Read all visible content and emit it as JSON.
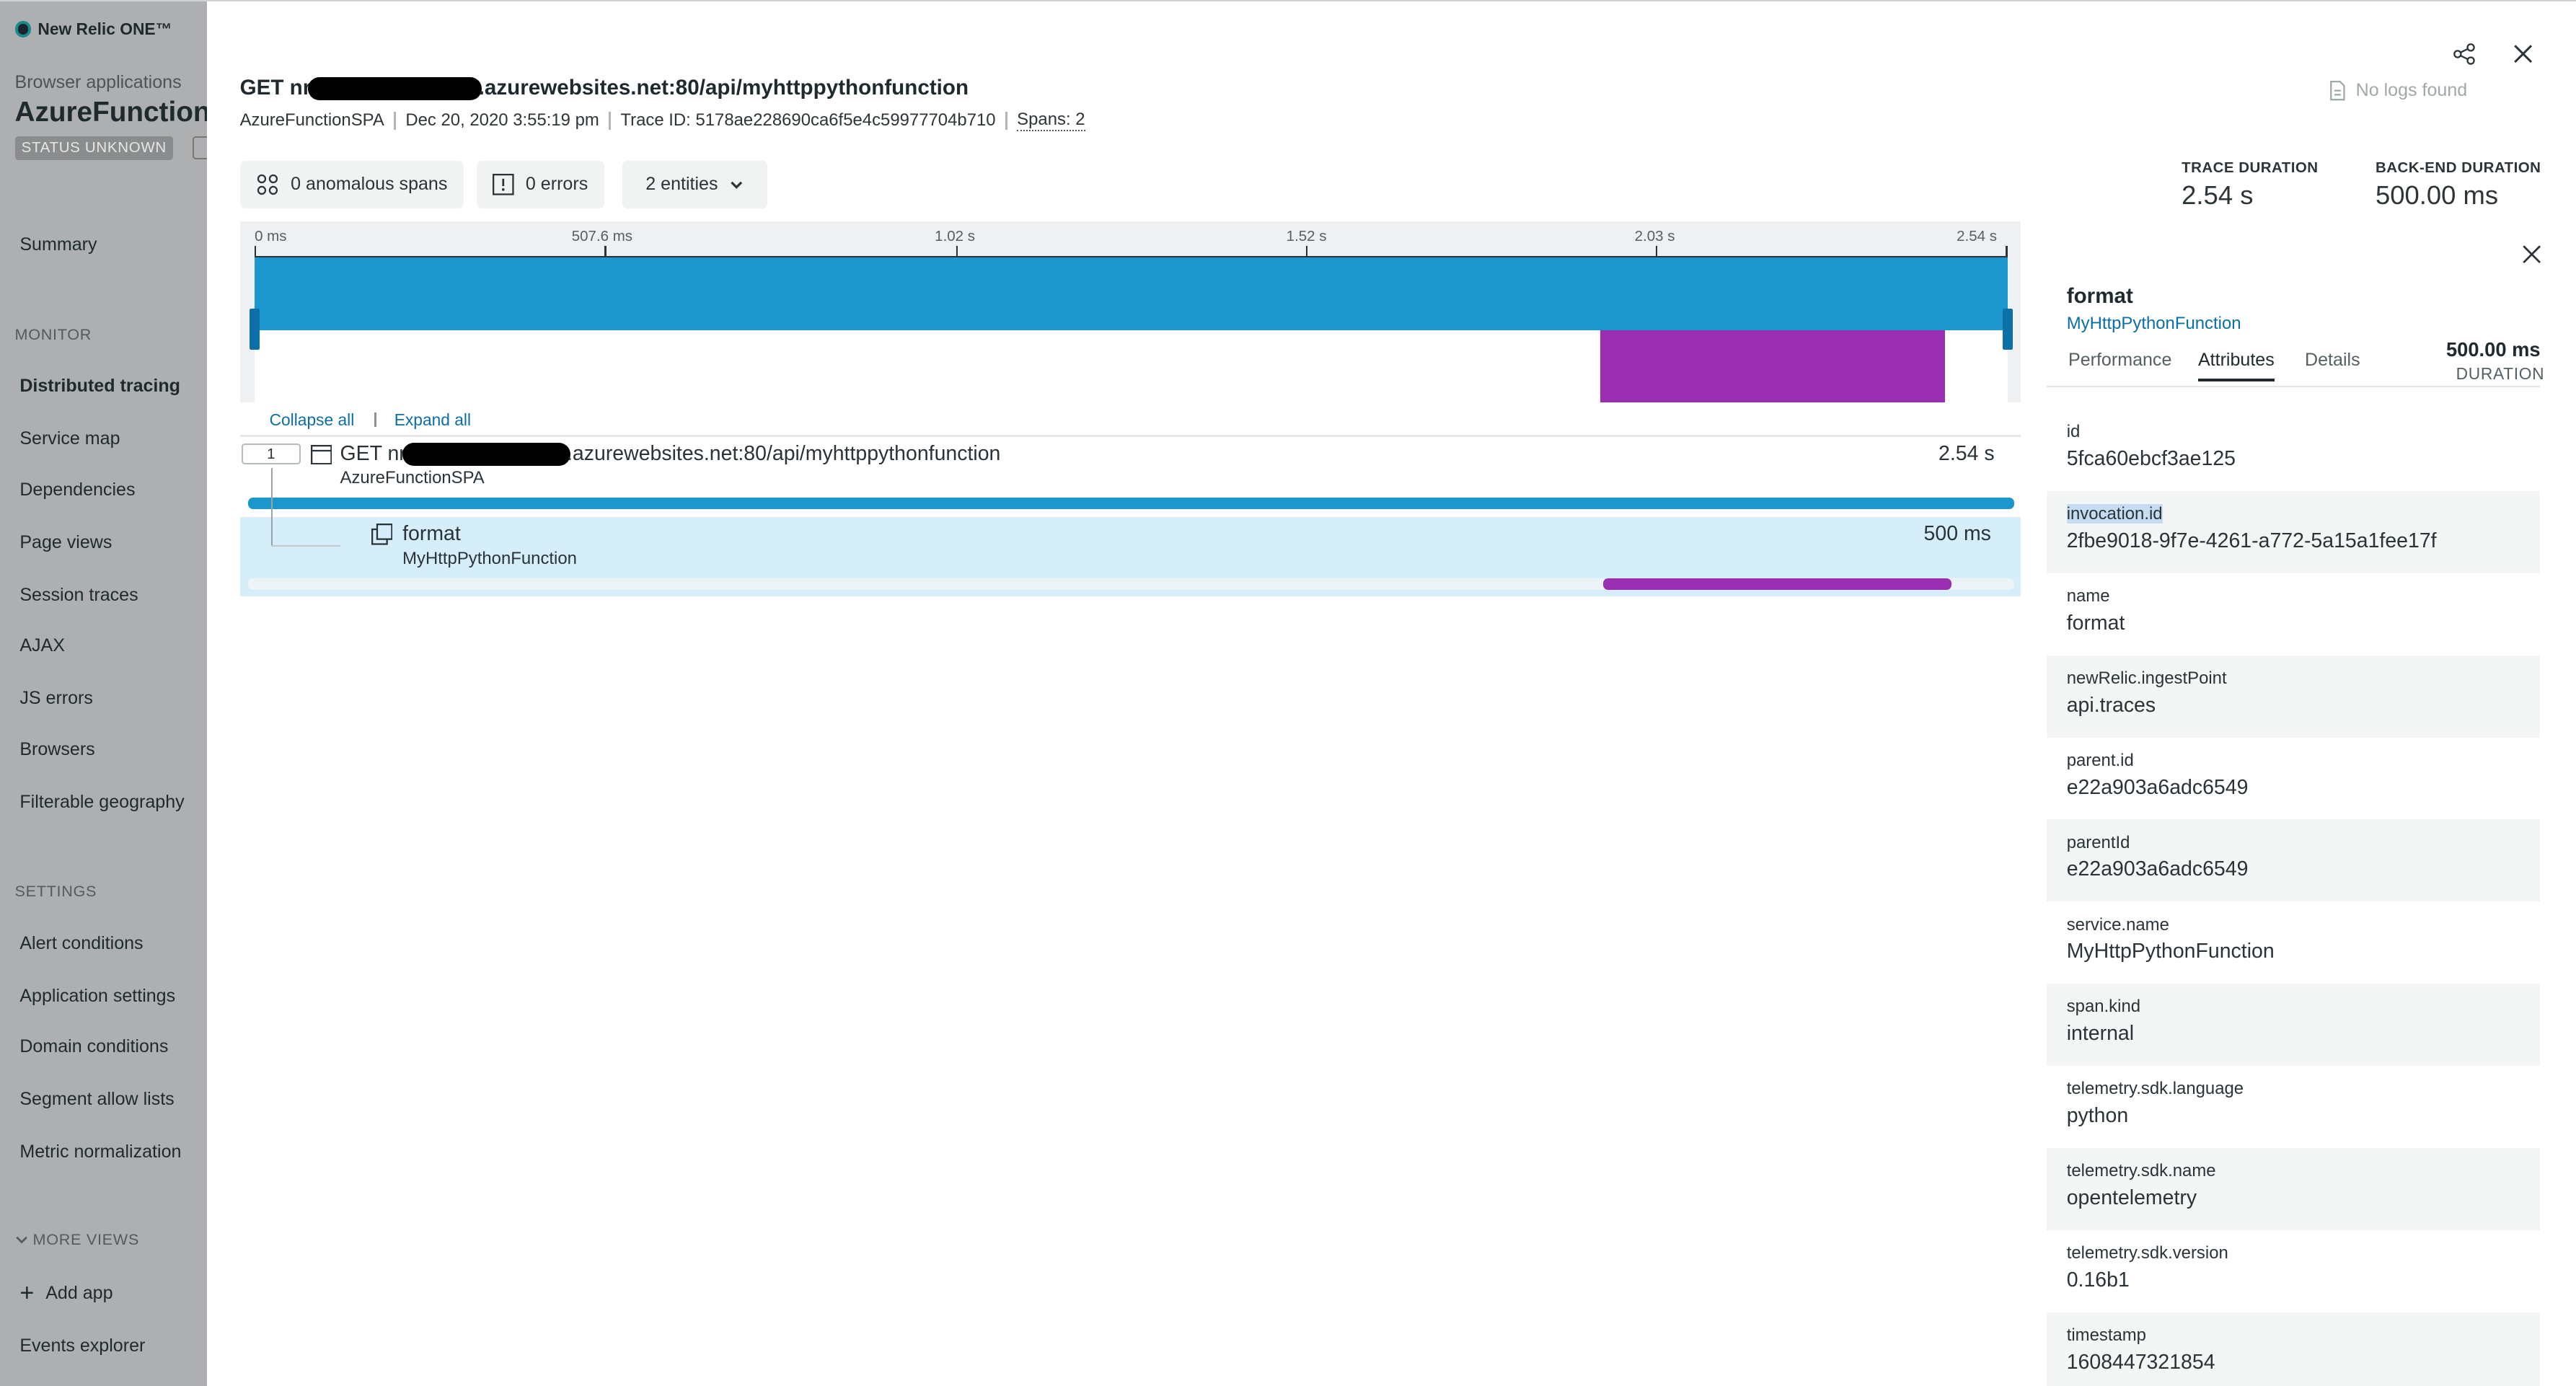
{
  "brand": {
    "name": "New Relic ONE™"
  },
  "sidebar": {
    "app_type": "Browser applications",
    "app_name": "AzureFunctionSPA",
    "status": "STATUS UNKNOWN",
    "items": [
      {
        "label": "Summary"
      },
      {
        "label": "Distributed tracing"
      },
      {
        "label": "Service map"
      },
      {
        "label": "Dependencies"
      },
      {
        "label": "Page views"
      },
      {
        "label": "Session traces"
      },
      {
        "label": "AJAX"
      },
      {
        "label": "JS errors"
      },
      {
        "label": "Browsers"
      },
      {
        "label": "Filterable geography"
      }
    ],
    "monitor_label": "MONITOR",
    "settings_label": "SETTINGS",
    "settings_items": [
      {
        "label": "Alert conditions"
      },
      {
        "label": "Application settings"
      },
      {
        "label": "Domain conditions"
      },
      {
        "label": "Segment allow lists"
      },
      {
        "label": "Metric normalization"
      }
    ],
    "more_views_label": "MORE VIEWS",
    "add_app": "Add app",
    "events_explorer": "Events explorer"
  },
  "trace": {
    "title_prefix": "GET nr",
    "title_suffix": ".azurewebsites.net:80/api/myhttppythonfunction",
    "app": "AzureFunctionSPA",
    "date": "Dec 20, 2020 3:55:19 pm",
    "trace_id": "Trace ID: 5178ae228690ca6f5e4c59977704b710",
    "spans": "Spans: 2"
  },
  "chips": {
    "anomalous": "0 anomalous spans",
    "errors": "0 errors",
    "entities": "2 entities"
  },
  "no_logs": "No logs found",
  "durations": {
    "trace_label": "TRACE DURATION",
    "trace_value": "2.54 s",
    "backend_label": "BACK-END DURATION",
    "backend_value": "500.00 ms"
  },
  "timeline": {
    "ticks": [
      "0 ms",
      "507.6 ms",
      "1.02 s",
      "1.52 s",
      "2.03 s",
      "2.54 s"
    ],
    "span_fill_color": "#1b97cd",
    "child_fill_color": "#9a2fb2"
  },
  "controls": {
    "collapse_all": "Collapse all",
    "expand_all": "Expand all"
  },
  "rows": [
    {
      "index": "1",
      "prefix": "GET nr",
      "suffix": ".azurewebsites.net:80/api/myhttppythonfunction",
      "sub": "AzureFunctionSPA",
      "duration": "2.54 s"
    },
    {
      "name": "format",
      "sub": "MyHttpPythonFunction",
      "duration": "500 ms"
    }
  ],
  "panel": {
    "title": "format",
    "subtitle": "MyHttpPythonFunction",
    "tabs": [
      "Performance",
      "Attributes",
      "Details"
    ],
    "active_tab": "Attributes",
    "duration_value": "500.00 ms",
    "duration_label": "DURATION",
    "attributes": [
      {
        "key": "id",
        "value": "5fca60ebcf3ae125"
      },
      {
        "key": "invocation.id",
        "value": "2fbe9018-9f7e-4261-a772-5a15a1fee17f"
      },
      {
        "key": "name",
        "value": "format"
      },
      {
        "key": "newRelic.ingestPoint",
        "value": "api.traces"
      },
      {
        "key": "parent.id",
        "value": "e22a903a6adc6549"
      },
      {
        "key": "parentId",
        "value": "e22a903a6adc6549"
      },
      {
        "key": "service.name",
        "value": "MyHttpPythonFunction"
      },
      {
        "key": "span.kind",
        "value": "internal"
      },
      {
        "key": "telemetry.sdk.language",
        "value": "python"
      },
      {
        "key": "telemetry.sdk.name",
        "value": "opentelemetry"
      },
      {
        "key": "telemetry.sdk.version",
        "value": "0.16b1"
      },
      {
        "key": "timestamp",
        "value": "1608447321854"
      }
    ]
  }
}
